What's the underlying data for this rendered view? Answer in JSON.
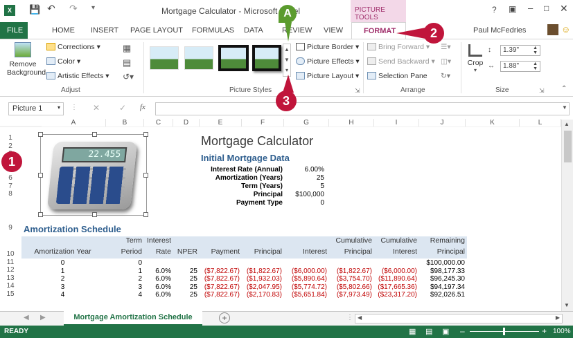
{
  "window": {
    "title": "Mortgage Calculator - Microsoft Excel",
    "context_title": "PICTURE TOOLS",
    "user": "Paul McFedries"
  },
  "tabs": [
    "FILE",
    "HOME",
    "INSERT",
    "PAGE LAYOUT",
    "FORMULAS",
    "DATA",
    "REVIEW",
    "VIEW",
    "FORMAT"
  ],
  "ribbon": {
    "remove_background": "Remove Background",
    "corrections": "Corrections",
    "color": "Color",
    "artistic": "Artistic Effects",
    "adjust": "Adjust",
    "picture_styles": "Picture Styles",
    "picture_border": "Picture Border",
    "picture_effects": "Picture Effects",
    "picture_layout": "Picture Layout",
    "bring_forward": "Bring Forward",
    "send_backward": "Send Backward",
    "selection_pane": "Selection Pane",
    "arrange": "Arrange",
    "crop": "Crop",
    "height": "1.39\"",
    "width": "1.88\"",
    "size": "Size"
  },
  "formula_bar": {
    "name_box": "Picture 1",
    "fx": "fx",
    "value": ""
  },
  "columns": [
    "A",
    "B",
    "C",
    "D",
    "E",
    "F",
    "G",
    "H",
    "I",
    "J",
    "K",
    "L"
  ],
  "rows": [
    "1",
    "2",
    "3",
    "4",
    "5",
    "6",
    "7",
    "8",
    "9",
    "10",
    "11",
    "12",
    "13",
    "14",
    "15"
  ],
  "calculator_display": "22.455",
  "sheet": {
    "title": "Mortgage Calculator",
    "section1": "Initial Mortgage Data",
    "inputs": [
      {
        "label": "Interest Rate (Annual)",
        "value": "6.00%"
      },
      {
        "label": "Amortization (Years)",
        "value": "25"
      },
      {
        "label": "Term (Years)",
        "value": "5"
      },
      {
        "label": "Principal",
        "value": "$100,000"
      },
      {
        "label": "Payment Type",
        "value": "0"
      }
    ],
    "section2": "Amortization Schedule",
    "headers_top": [
      "",
      "Term",
      "Interest",
      "",
      "",
      "",
      "",
      "Cumulative",
      "Cumulative",
      "Remaining"
    ],
    "headers": [
      "Amortization Year",
      "Period",
      "Rate",
      "NPER",
      "Payment",
      "Principal",
      "Interest",
      "Principal",
      "Interest",
      "Principal"
    ],
    "rows": [
      [
        "0",
        "0",
        "",
        "",
        "",
        "",
        "",
        "",
        "",
        "$100,000.00"
      ],
      [
        "1",
        "1",
        "6.0%",
        "25",
        "($7,822.67)",
        "($1,822.67)",
        "($6,000.00)",
        "($1,822.67)",
        "($6,000.00)",
        "$98,177.33"
      ],
      [
        "2",
        "2",
        "6.0%",
        "25",
        "($7,822.67)",
        "($1,932.03)",
        "($5,890.64)",
        "($3,754.70)",
        "($11,890.64)",
        "$96,245.30"
      ],
      [
        "3",
        "3",
        "6.0%",
        "25",
        "($7,822.67)",
        "($2,047.95)",
        "($5,774.72)",
        "($5,802.66)",
        "($17,665.36)",
        "$94,197.34"
      ],
      [
        "4",
        "4",
        "6.0%",
        "25",
        "($7,822.67)",
        "($2,170.83)",
        "($5,651.84)",
        "($7,973.49)",
        "($23,317.20)",
        "$92,026.51"
      ]
    ]
  },
  "sheet_tab": "Mortgage Amortization Schedule",
  "status": {
    "ready": "READY",
    "zoom": "100%"
  },
  "callouts": [
    "1",
    "2",
    "3",
    "A"
  ],
  "colors": {
    "accent": "#217346",
    "callout": "#c0153b",
    "context": "#a0306c"
  }
}
